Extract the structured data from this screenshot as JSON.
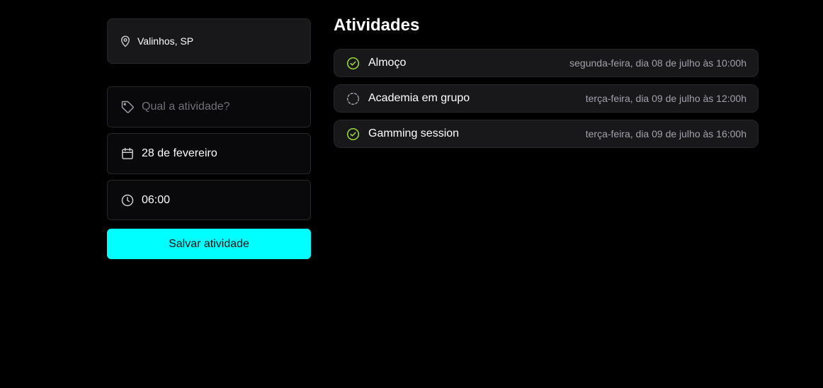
{
  "location": {
    "icon": "map-pin-icon",
    "text": "Valinhos, SP"
  },
  "form": {
    "activity": {
      "icon": "tag-icon",
      "placeholder": "Qual a atividade?",
      "value": ""
    },
    "date": {
      "icon": "calendar-icon",
      "value": "28 de fevereiro"
    },
    "time": {
      "icon": "clock-icon",
      "value": "06:00"
    },
    "save_label": "Salvar atividade"
  },
  "activities": {
    "title": "Atividades",
    "items": [
      {
        "name": "Almoço",
        "date": "segunda-feira, dia 08 de julho às 10:00h",
        "status": "done",
        "icon": "check-circle-icon"
      },
      {
        "name": "Academia em grupo",
        "date": "terça-feira, dia 09 de julho às 12:00h",
        "status": "pending",
        "icon": "dashed-circle-icon"
      },
      {
        "name": "Gamming session",
        "date": "terça-feira, dia 09 de julho às 16:00h",
        "status": "done",
        "icon": "check-circle-icon"
      }
    ]
  },
  "colors": {
    "accent": "#00ffff",
    "check": "#a3e635",
    "card": "#18181b",
    "field": "#09090b",
    "border": "#27272a",
    "muted_text": "#a1a1aa"
  }
}
